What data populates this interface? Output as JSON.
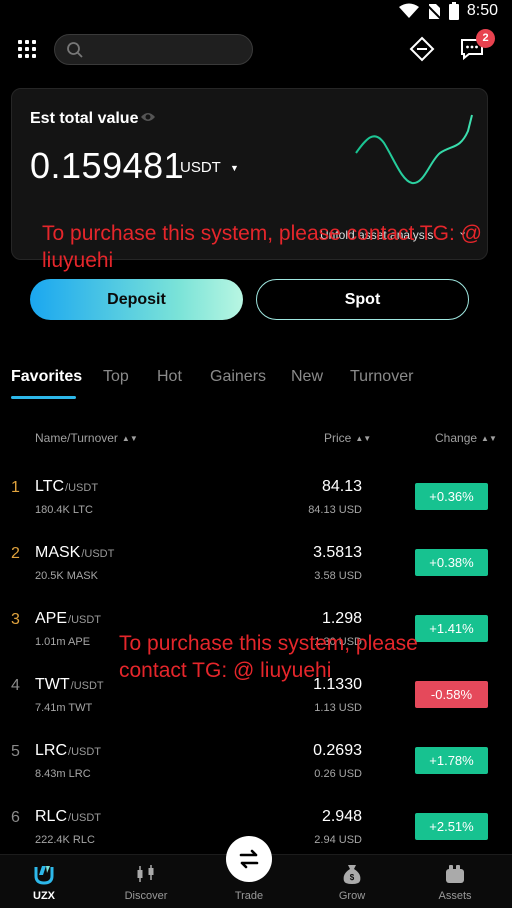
{
  "status_bar": {
    "time": "8:50"
  },
  "search": {
    "placeholder": ""
  },
  "notifications": {
    "badge_count": "2"
  },
  "asset_card": {
    "title": "Est total value",
    "value": "0.159481",
    "unit": "USDT",
    "analysis_link": "Unfold asset analysis"
  },
  "watermark": {
    "text1": "To purchase this system, please contact TG: @ liuyuehi",
    "text2": "To purchase this system, please contact TG: @ liuyuehi"
  },
  "actions": {
    "deposit": "Deposit",
    "spot": "Spot"
  },
  "tabs": [
    {
      "label": "Favorites",
      "active": true
    },
    {
      "label": "Top"
    },
    {
      "label": "Hot"
    },
    {
      "label": "Gainers"
    },
    {
      "label": "New"
    },
    {
      "label": "Turnover"
    }
  ],
  "table_header": {
    "name": "Name/Turnover",
    "price": "Price",
    "change": "Change"
  },
  "rows": [
    {
      "rank": "1",
      "symbol": "LTC",
      "quote": "/USDT",
      "volume": "180.4K LTC",
      "price": "84.13",
      "usd": "84.13 USD",
      "change": "+0.36%",
      "dir": "up"
    },
    {
      "rank": "2",
      "symbol": "MASK",
      "quote": "/USDT",
      "volume": "20.5K MASK",
      "price": "3.5813",
      "usd": "3.58 USD",
      "change": "+0.38%",
      "dir": "up"
    },
    {
      "rank": "3",
      "symbol": "APE",
      "quote": "/USDT",
      "volume": "1.01m APE",
      "price": "1.298",
      "usd": "1.30 USD",
      "change": "+1.41%",
      "dir": "up"
    },
    {
      "rank": "4",
      "symbol": "TWT",
      "quote": "/USDT",
      "volume": "7.41m TWT",
      "price": "1.1330",
      "usd": "1.13 USD",
      "change": "-0.58%",
      "dir": "down"
    },
    {
      "rank": "5",
      "symbol": "LRC",
      "quote": "/USDT",
      "volume": "8.43m LRC",
      "price": "0.2693",
      "usd": "0.26 USD",
      "change": "+1.78%",
      "dir": "up"
    },
    {
      "rank": "6",
      "symbol": "RLC",
      "quote": "/USDT",
      "volume": "222.4K RLC",
      "price": "2.948",
      "usd": "2.94 USD",
      "change": "+2.51%",
      "dir": "up"
    }
  ],
  "bottom_nav": [
    {
      "label": "UZX",
      "icon": "uzx-logo-icon",
      "active": true
    },
    {
      "label": "Discover",
      "icon": "candlestick-icon"
    },
    {
      "label": "Trade",
      "icon": "swap-arrows-icon"
    },
    {
      "label": "Grow",
      "icon": "money-bag-icon"
    },
    {
      "label": "Assets",
      "icon": "wallet-icon"
    }
  ],
  "colors": {
    "up": "#17c290",
    "down": "#e5495b",
    "accent": "#2db8ea",
    "rank_top": "#e0a33e"
  }
}
